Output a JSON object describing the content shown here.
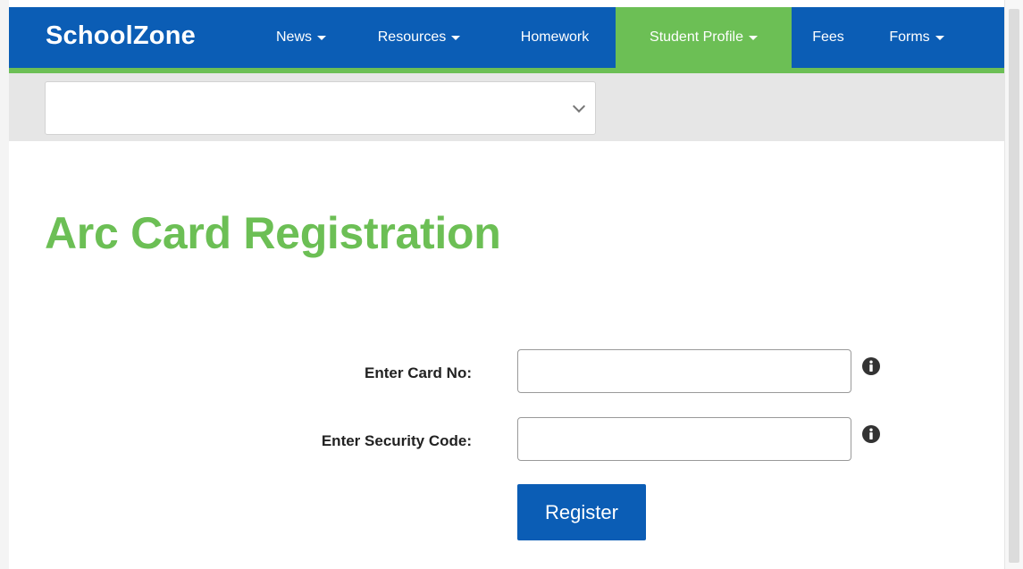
{
  "header": {
    "brand": "SchoolZone",
    "nav": [
      {
        "label": "News",
        "dropdown": true
      },
      {
        "label": "Resources",
        "dropdown": true
      },
      {
        "label": "Homework",
        "dropdown": false
      },
      {
        "label": "Student Profile",
        "dropdown": true,
        "active": true
      },
      {
        "label": "Fees",
        "dropdown": false
      },
      {
        "label": "Forms",
        "dropdown": true
      }
    ]
  },
  "school_selector": {
    "value": ""
  },
  "page": {
    "title": "Arc Card Registration"
  },
  "form": {
    "card_label": "Enter Card No:",
    "card_value": "",
    "security_label": "Enter Security Code:",
    "security_value": "",
    "submit_label": "Register",
    "info_icon": "info-circle-icon"
  },
  "colors": {
    "nav_blue": "#0b5db5",
    "accent_green": "#6cbf55",
    "band_grey": "#e6e6e6"
  }
}
